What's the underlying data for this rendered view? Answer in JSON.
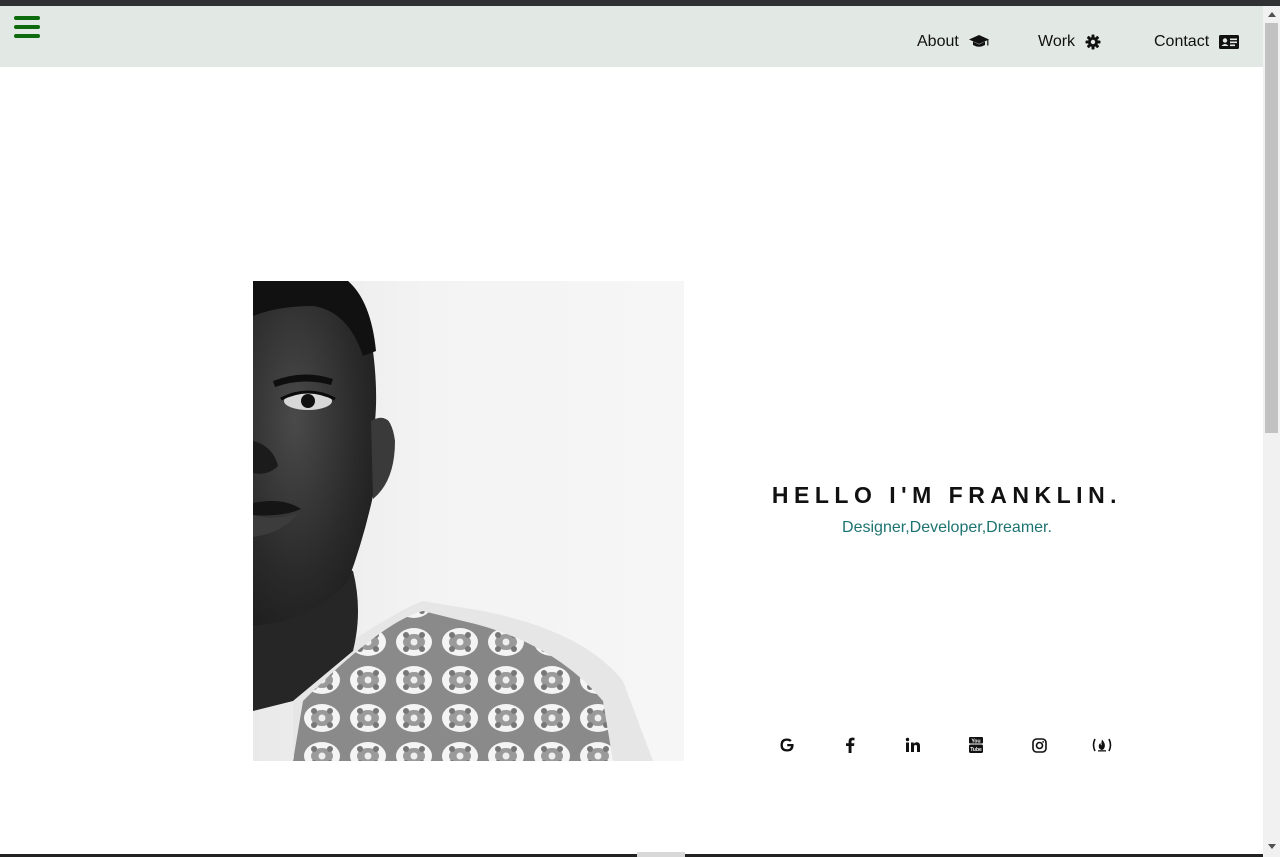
{
  "nav": {
    "menu_icon": "hamburger-menu-icon",
    "items": [
      {
        "label": "About",
        "icon": "graduation-cap-icon"
      },
      {
        "label": "Work",
        "icon": "gear-icon"
      },
      {
        "label": "Contact",
        "icon": "id-card-icon"
      }
    ]
  },
  "hero": {
    "title": "HELLO I'M FRANKLIN.",
    "subtitle": "Designer,Developer,Dreamer.",
    "image": "black-and-white-portrait-photo"
  },
  "social": [
    {
      "icon": "google-icon"
    },
    {
      "icon": "facebook-icon"
    },
    {
      "icon": "linkedin-icon"
    },
    {
      "icon": "youtube-icon"
    },
    {
      "icon": "instagram-icon"
    },
    {
      "icon": "freecodecamp-icon"
    }
  ],
  "colors": {
    "navbar_bg": "#e2e9e5",
    "menu_icon": "#0d6b0d",
    "subtitle": "#1d7372",
    "title": "#111111"
  }
}
